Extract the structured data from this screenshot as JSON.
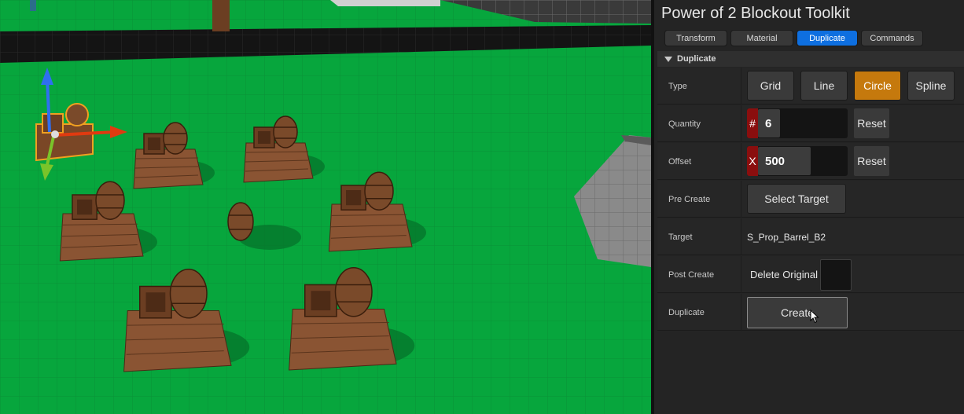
{
  "panel": {
    "title": "Power of 2 Blockout Toolkit",
    "tabs": [
      {
        "label": "Transform",
        "active": false
      },
      {
        "label": "Material",
        "active": false
      },
      {
        "label": "Duplicate",
        "active": true
      },
      {
        "label": "Commands",
        "active": false
      }
    ],
    "section": "Duplicate",
    "rows": {
      "type": {
        "label": "Type",
        "options": [
          "Grid",
          "Line",
          "Circle",
          "Spline"
        ],
        "selected": "Circle"
      },
      "quantity": {
        "label": "Quantity",
        "axis": "#",
        "value": "6",
        "reset": "Reset"
      },
      "offset": {
        "label": "Offset",
        "axis": "X",
        "value": "500",
        "reset": "Reset"
      },
      "pre_create": {
        "label": "Pre Create",
        "button": "Select Target"
      },
      "target": {
        "label": "Target",
        "value": "S_Prop_Barrel_B2"
      },
      "post_create": {
        "label": "Post Create",
        "option": "Delete Original",
        "checked": false
      },
      "duplicate": {
        "label": "Duplicate",
        "button": "Create"
      }
    }
  },
  "colors": {
    "accent_tab": "#0e6fe0",
    "selected_option": "#c5790d",
    "axis_red": "#8a0e0e",
    "floor_green": "#07a63d"
  },
  "viewport": {
    "description_icons": [
      "translate-gizmo-icon",
      "barrel-prop",
      "crate-prop",
      "pallet-prop"
    ]
  }
}
